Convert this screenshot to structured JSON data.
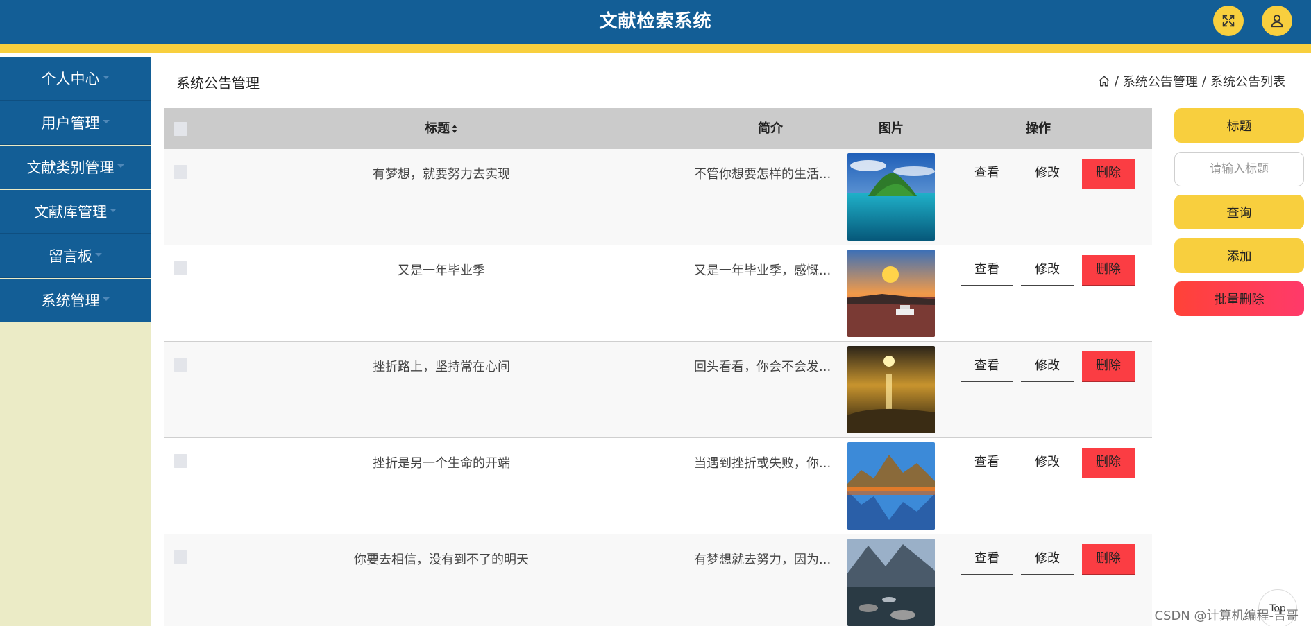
{
  "header": {
    "title": "文献检索系统",
    "fullscreen_icon": "fullscreen-icon",
    "user_icon": "user-icon"
  },
  "sidebar": {
    "items": [
      {
        "label": "个人中心"
      },
      {
        "label": "用户管理"
      },
      {
        "label": "文献类别管理"
      },
      {
        "label": "文献库管理"
      },
      {
        "label": "留言板"
      },
      {
        "label": "系统管理"
      }
    ]
  },
  "page": {
    "title": "系统公告管理",
    "breadcrumb": [
      "系统公告管理",
      "系统公告列表"
    ],
    "breadcrumb_sep": "/"
  },
  "table": {
    "columns": {
      "title": "标题",
      "intro": "简介",
      "image": "图片",
      "actions": "操作"
    },
    "actions": {
      "view": "查看",
      "edit": "修改",
      "delete": "删除"
    },
    "rows": [
      {
        "title": "有梦想，就要努力去实现",
        "intro": "不管你想要怎样的生活...",
        "image": "island-lagoon"
      },
      {
        "title": "又是一年毕业季",
        "intro": "又是一年毕业季，感慨...",
        "image": "sunset-river-boat"
      },
      {
        "title": "挫折路上，坚持常在心间",
        "intro": "回头看看，你会不会发...",
        "image": "sunset-sea-shore"
      },
      {
        "title": "挫折是另一个生命的开端",
        "intro": "当遇到挫折或失败，你...",
        "image": "mountain-lake-reflection"
      },
      {
        "title": "你要去相信，没有到不了的明天",
        "intro": "有梦想就去努力，因为...",
        "image": "mountain-stream-rocks"
      }
    ]
  },
  "search_panel": {
    "field_label": "标题",
    "input_placeholder": "请输入标题",
    "query_label": "查询",
    "add_label": "添加",
    "batch_delete_label": "批量删除"
  },
  "footer": {
    "top_label": "Top",
    "watermark": "CSDN @计算机编程-吉哥"
  },
  "colors": {
    "primary": "#135e96",
    "accent": "#f8cf3e",
    "danger": "#fb3d43",
    "sidebar_bg": "#ebebc6"
  }
}
